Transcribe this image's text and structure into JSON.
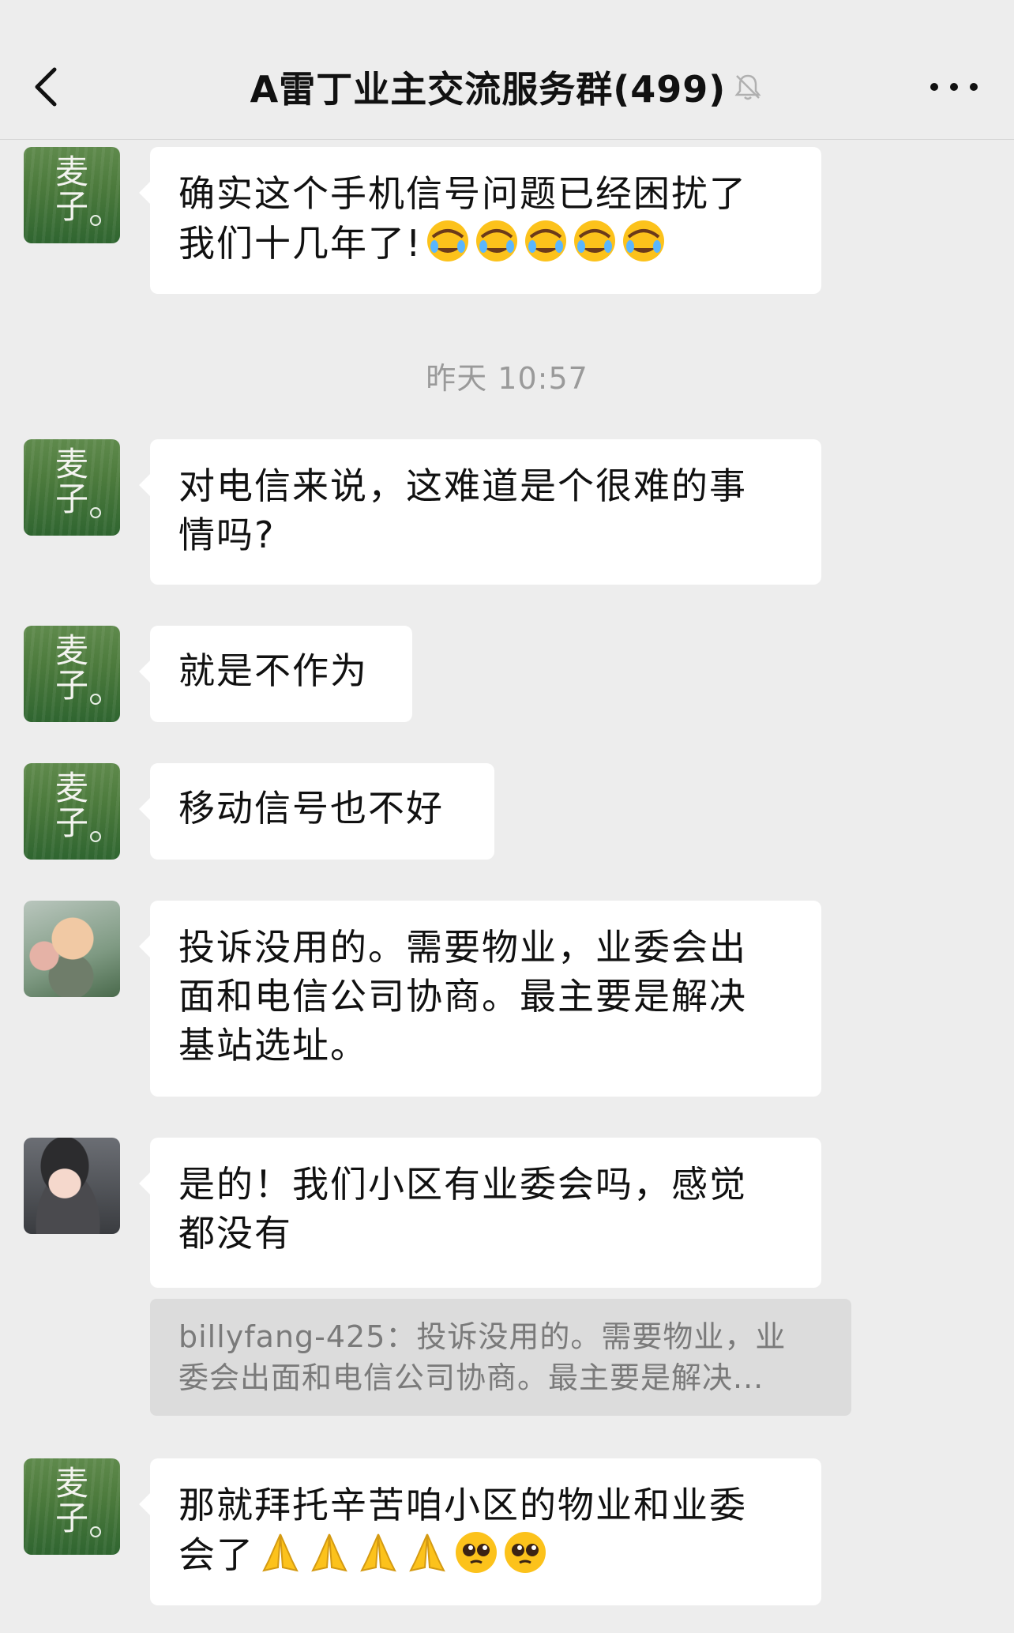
{
  "header": {
    "title": "A雷丁业主交流服务群(499)",
    "back_icon": "chevron-left-icon",
    "mute_icon": "bell-off-icon",
    "more_icon": "more-dots-icon"
  },
  "timestamp": "昨天 10:57",
  "messages": [
    {
      "avatar": "wheat",
      "lines": [
        "确实这个手机信号问题已经困扰了",
        "我们十几年了!"
      ],
      "emoji": [
        "facepalm-cry",
        "facepalm-cry",
        "facepalm-cry",
        "facepalm-cry",
        "facepalm-cry"
      ]
    },
    {
      "avatar": "wheat",
      "lines": [
        "对电信来说，这难道是个很难的事",
        "情吗?"
      ]
    },
    {
      "avatar": "wheat",
      "lines": [
        "就是不作为"
      ]
    },
    {
      "avatar": "wheat",
      "lines": [
        "移动信号也不好"
      ]
    },
    {
      "avatar": "baby",
      "lines": [
        "投诉没用的。需要物业，业委会出",
        "面和电信公司协商。最主要是解决",
        "基站选址。"
      ]
    },
    {
      "avatar": "girl",
      "lines": [
        "是的！我们小区有业委会吗，感觉",
        "都没有"
      ]
    },
    {
      "avatar": "wheat",
      "lines": [
        "那就拜托辛苦咱小区的物业和业委",
        "会了"
      ],
      "emoji": [
        "praying-hands",
        "praying-hands",
        "praying-hands",
        "praying-hands",
        "pleading-face",
        "pleading-face"
      ]
    }
  ],
  "quote": {
    "line1": "billyfang-425：投诉没用的。需要物业，业",
    "line2": "委会出面和电信公司协商。最主要是解决..."
  },
  "avatar_labels": {
    "wheat": "麦子"
  },
  "colors": {
    "background": "#ededed",
    "bubble": "#ffffff",
    "quote_bg": "#dcdcdc",
    "timestamp": "#9a9a9a"
  }
}
